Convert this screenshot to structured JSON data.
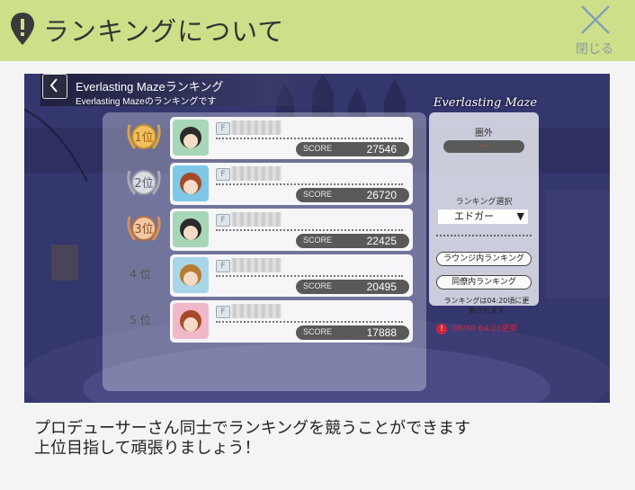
{
  "header": {
    "title": "ランキングについて",
    "close_label": "閉じる"
  },
  "screenshot": {
    "title": "Everlasting Mazeランキング",
    "subtitle": "Everlasting Mazeのランキングです",
    "logo_text": "Everlasting Maze",
    "score_label": "SCORE",
    "rankings": [
      {
        "rank_label": "1位",
        "score": "27546",
        "medal": "gold"
      },
      {
        "rank_label": "2位",
        "score": "26720",
        "medal": "silver"
      },
      {
        "rank_label": "3位",
        "score": "22425",
        "medal": "bronze"
      },
      {
        "rank_label": "4 位",
        "score": "20495",
        "medal": "none"
      },
      {
        "rank_label": "5 位",
        "score": "17888",
        "medal": "none"
      }
    ],
    "fan_badge": "F",
    "side_panel": {
      "out_of_rank_label": "圏外",
      "out_of_rank_value": "---",
      "select_label": "ランキング選択",
      "select_value": "エドガー",
      "lounge_button": "ラウンジ内ランキング",
      "colleague_button": "同僚内ランキング",
      "update_note": "ランキングは04:20頃に更新されます",
      "update_time": "08/30 04:20更新"
    }
  },
  "description": {
    "line1": "プロデューサーさん同士でランキングを競うことができます",
    "line2": "上位目指して頑張りましょう！"
  },
  "colors": {
    "header_bg": "#cde089",
    "accent_red": "#d0243a",
    "close_icon": "#7fa4b0"
  }
}
